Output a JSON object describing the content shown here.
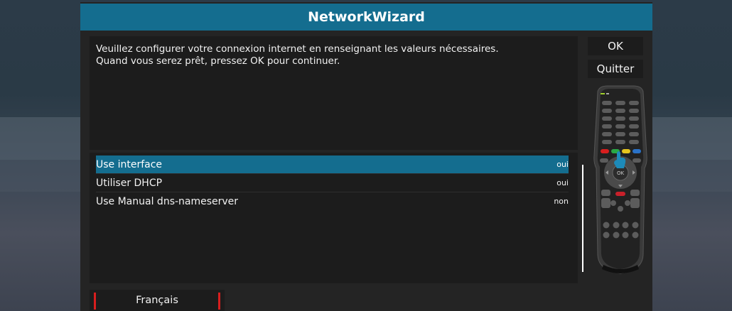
{
  "window": {
    "title": "NetworkWizard"
  },
  "description": {
    "line1": "Veuillez configurer votre connexion internet en renseignant les valeurs nécessaires.",
    "line2": "Quand vous serez prêt, pressez OK pour continuer."
  },
  "settings": [
    {
      "label": "Use interface",
      "value": "oui",
      "selected": true
    },
    {
      "label": "Utiliser DHCP",
      "value": "oui",
      "selected": false
    },
    {
      "label": "Use Manual dns-nameserver",
      "value": "non",
      "selected": false
    }
  ],
  "buttons": {
    "ok_label": "OK",
    "quit_label": "Quitter"
  },
  "language": {
    "label": "Français"
  },
  "remote": {
    "ok_key_label": "OK"
  },
  "colors": {
    "accent": "#146d8f",
    "panel": "#1c1c1c",
    "window": "#242424",
    "red": "#d81e1e",
    "green": "#2aa845",
    "yellow": "#e6c51e",
    "blue": "#2a72c8"
  },
  "icons": {
    "remote": "remote-control-icon",
    "pointer": "hand-pointer-icon"
  }
}
